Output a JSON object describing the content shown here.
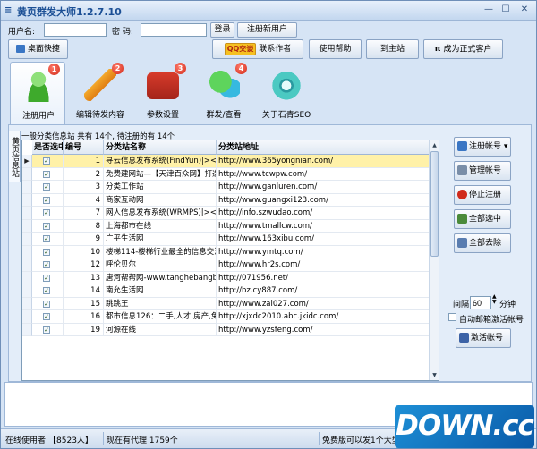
{
  "window": {
    "title": "黄页群发大师1.2.7.10"
  },
  "login": {
    "username_label": "用户名:",
    "password_label": "密  码:",
    "username_value": "",
    "password_value": "",
    "login_button": "登录",
    "register_button": "注册新用户"
  },
  "toolbar": {
    "desktop_shortcut": "桌面快捷",
    "qq_chat": "QQ交谈",
    "contact_author": "联系作者",
    "help": "使用帮助",
    "go_site": "到主站",
    "become_customer": "成为正式客户",
    "pi_symbol": "π"
  },
  "tools": [
    {
      "label": "注册用户",
      "badge": "1"
    },
    {
      "label": "编辑待发内容",
      "badge": "2"
    },
    {
      "label": "参数设置",
      "badge": "3"
    },
    {
      "label": "群发/查看",
      "badge": "4"
    },
    {
      "label": "关于石青SEO",
      "badge": ""
    }
  ],
  "side_tab": "黄页信息站",
  "summary": "一般分类信息站 共有 14个, 待注册的有 14个",
  "grid": {
    "headers": [
      "是否选中",
      "编号",
      "分类站名称",
      "分类站地址"
    ],
    "rows": [
      {
        "id": "1",
        "name": "寻云信息发布系统(FindYun)|><最",
        "url": "http://www.365yongnian.com/"
      },
      {
        "id": "2",
        "name": "免费建网站—【天津百众网】打造",
        "url": "http://www.tcwpw.com/"
      },
      {
        "id": "3",
        "name": "分类工作站",
        "url": "http://www.ganluren.com/"
      },
      {
        "id": "4",
        "name": "商家互动网",
        "url": "http://www.guangxi123.com/"
      },
      {
        "id": "7",
        "name": "网人信息发布系统(WRMPS)|><最",
        "url": "http://info.szwudao.com/"
      },
      {
        "id": "8",
        "name": "上海都市在线",
        "url": "http://www.tmallcw.com/"
      },
      {
        "id": "9",
        "name": "广平生活网",
        "url": "http://www.163xibu.com/"
      },
      {
        "id": "10",
        "name": "楼梯114-楼梯行业最全的信息交流",
        "url": "http://www.ymtq.com/"
      },
      {
        "id": "12",
        "name": "呼伦贝尔",
        "url": "http://www.hr2s.com/"
      },
      {
        "id": "13",
        "name": "唐河帮帮网-www.tanghebangbang",
        "url": "http://071956.net/"
      },
      {
        "id": "14",
        "name": "南允生活网",
        "url": "http://bz.cy887.com/"
      },
      {
        "id": "15",
        "name": "跳跳王",
        "url": "http://www.zai027.com/"
      },
      {
        "id": "16",
        "name": "都市信息126：二手,人才,房产,免",
        "url": "http://xjxdc2010.abc.jkidc.com/"
      },
      {
        "id": "19",
        "name": "河源在线",
        "url": "http://www.yzsfeng.com/"
      }
    ]
  },
  "right_panel": {
    "register_account": "注册帐号",
    "manage_account": "管理帐号",
    "stop_register": "停止注册",
    "select_all": "全部选中",
    "deselect_all": "全部去除",
    "interval_label": "间隔",
    "interval_value": "60",
    "interval_unit": "分钟",
    "auto_activate": "自动邮箱激活帐号",
    "activate_account": "激活帐号"
  },
  "status": {
    "online": "在线使用者:【8523人】",
    "proxy": "现在有代理 1759个",
    "free_note": "免费版可以发1个大型"
  },
  "watermark": "DOWN.cc"
}
